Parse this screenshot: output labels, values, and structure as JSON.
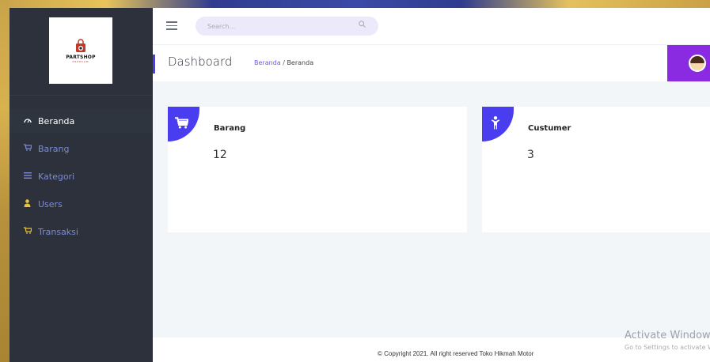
{
  "brand": {
    "logo_text": "PARTSHOP",
    "logo_sub": "PREMIUM"
  },
  "header": {
    "search_placeholder": "Search..."
  },
  "sidebar": {
    "items": [
      {
        "label": "Beranda",
        "icon": "dashboard-icon",
        "active": true
      },
      {
        "label": "Barang",
        "icon": "cart-icon"
      },
      {
        "label": "Kategori",
        "icon": "list-icon"
      },
      {
        "label": "Users",
        "icon": "user-icon"
      },
      {
        "label": "Transaksi",
        "icon": "cart-icon"
      }
    ]
  },
  "titlebar": {
    "title": "Dashboard",
    "breadcrumb_link": "Beranda",
    "breadcrumb_sep": " / ",
    "breadcrumb_current": "Beranda"
  },
  "cards": [
    {
      "label": "Barang",
      "value": "12",
      "icon": "cart-icon"
    },
    {
      "label": "Custumer",
      "value": "3",
      "icon": "person-icon"
    }
  ],
  "footer": {
    "copyright": "© Copyright 2021. All right reserved Toko Hikmah Motor"
  },
  "watermark": {
    "line1": "Activate Windows",
    "line2": "Go to Settings to activate Windows."
  },
  "colors": {
    "accent": "#4a3df0",
    "sidebar": "#2c313b",
    "profile": "#8a2be2",
    "content_bg": "#f2f6f9"
  }
}
